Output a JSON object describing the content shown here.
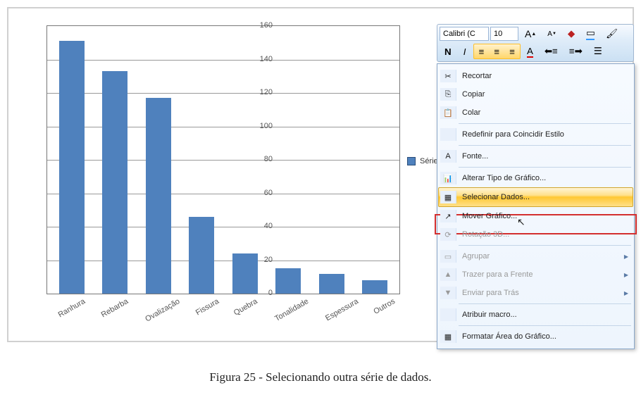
{
  "chart_data": {
    "type": "bar",
    "categories": [
      "Ranhura",
      "Rebarba",
      "Ovalização",
      "Fissura",
      "Quebra",
      "Tonalidade",
      "Espessura",
      "Outros"
    ],
    "values": [
      151,
      133,
      117,
      46,
      24,
      15,
      12,
      8
    ],
    "ylim": [
      0,
      160
    ],
    "ystep": 20,
    "title": "",
    "xlabel": "",
    "ylabel": ""
  },
  "legend": {
    "label": "Série"
  },
  "mini_toolbar": {
    "font_name": "Calibri (C",
    "font_size": "10",
    "grow_fn": "A",
    "shrink_fn": "A",
    "bold": "N",
    "italic": "I",
    "font_color": "A"
  },
  "context_menu": {
    "items": [
      {
        "key": "cut",
        "label": "Recortar",
        "accel": "",
        "icon": "scissors",
        "enabled": true
      },
      {
        "key": "copy",
        "label": "Copiar",
        "accel": "",
        "icon": "copy",
        "enabled": true
      },
      {
        "key": "paste",
        "label": "Colar",
        "accel": "",
        "icon": "paste",
        "enabled": true
      },
      {
        "key": "reset",
        "label": "Redefinir para Coincidir Estilo",
        "accel": "",
        "icon": "",
        "enabled": true
      },
      {
        "key": "font",
        "label": "Fonte...",
        "accel": "",
        "icon": "font",
        "enabled": true
      },
      {
        "key": "ctype",
        "label": "Alterar Tipo de Gráfico...",
        "accel": "",
        "icon": "chart",
        "enabled": true
      },
      {
        "key": "seldata",
        "label": "Selecionar Dados...",
        "accel": "",
        "icon": "seldata",
        "enabled": true
      },
      {
        "key": "move",
        "label": "Mover Gráfico...",
        "accel": "",
        "icon": "move",
        "enabled": true
      },
      {
        "key": "rot3d",
        "label": "Rotação 3D...",
        "accel": "",
        "icon": "rot3d",
        "enabled": false
      },
      {
        "key": "group",
        "label": "Agrupar",
        "accel": "",
        "icon": "group",
        "enabled": false,
        "submenu": true
      },
      {
        "key": "front",
        "label": "Trazer para a Frente",
        "accel": "",
        "icon": "front",
        "enabled": false,
        "submenu": true
      },
      {
        "key": "back",
        "label": "Enviar para Trás",
        "accel": "",
        "icon": "back",
        "enabled": false,
        "submenu": true
      },
      {
        "key": "macro",
        "label": "Atribuir macro...",
        "accel": "",
        "icon": "",
        "enabled": true
      },
      {
        "key": "format",
        "label": "Formatar Área do Gráfico...",
        "accel": "",
        "icon": "fmt",
        "enabled": true
      }
    ],
    "highlighted": "seldata"
  },
  "caption": "Figura 25 - Selecionando outra série de dados."
}
